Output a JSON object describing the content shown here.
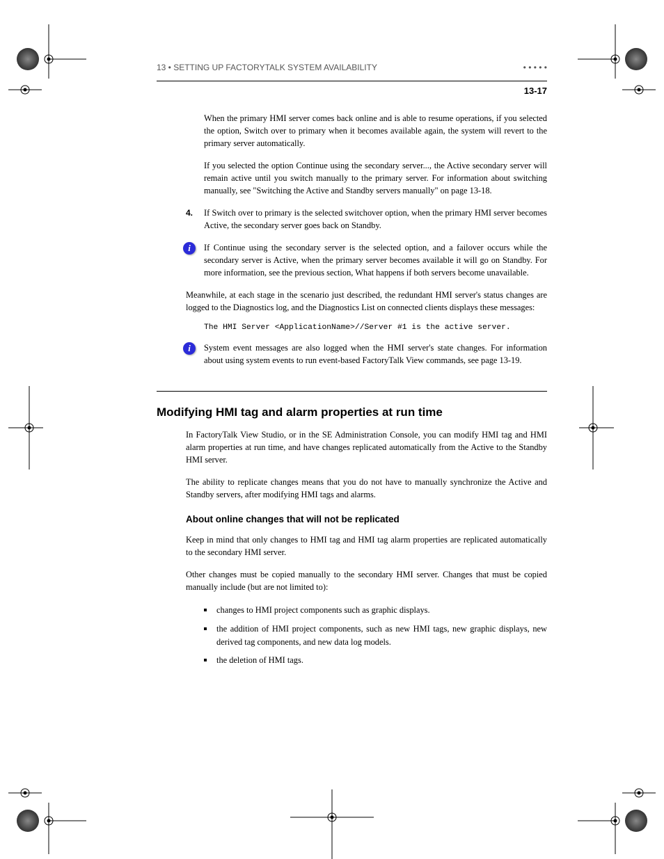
{
  "header": {
    "left": "13 • SETTING UP FACTORYTALK SYSTEM AVAILABILITY",
    "right": "• • • • •",
    "section_number": "13-17"
  },
  "para1": "When the primary HMI server comes back online and is able to resume operations, if you selected the option, Switch over to primary when it becomes available again, the system will revert to the primary server automatically.",
  "para2": "If you selected the option Continue using the secondary server..., the Active secondary server will remain active until you switch manually to the primary server. For information about switching manually, see \"Switching the Active and Standby servers manually\" on page 13-18.",
  "step1_num": "4.",
  "step1": "If Switch over to primary is the selected switchover option, when the primary HMI server becomes Active, the secondary server goes back on Standby.",
  "note1": "If Continue using the secondary server is the selected option, and a failover occurs while the secondary server is Active, when the primary server becomes available it will go on Standby. For more information, see the previous section, What happens if both servers become unavailable.",
  "para3": "Meanwhile, at each stage in the scenario just described, the redundant HMI server's status changes are logged to the Diagnostics log, and the Diagnostics List on connected clients displays these messages:",
  "code_line": "The HMI Server <ApplicationName>//Server #1 is the active server.",
  "note2": "System event messages are also logged when the HMI server's state changes. For information about using system events to run event-based FactoryTalk View commands, see page 13-19.",
  "h2": "Modifying HMI tag and alarm properties at run time",
  "para4": "In FactoryTalk View Studio, or in the SE Administration Console, you can modify HMI tag and HMI alarm properties at run time, and have changes replicated automatically from the Active to the Standby HMI server.",
  "para5": "The ability to replicate changes means that you do not have to manually synchronize the Active and Standby servers, after modifying HMI tags and alarms.",
  "h3": "About online changes that will not be replicated",
  "para6": "Keep in mind that only changes to HMI tag and HMI tag alarm properties are replicated automatically to the secondary HMI server.",
  "para7": "Other changes must be copied manually to the secondary HMI server. Changes that must be copied manually include (but are not limited to):",
  "bullets": [
    "changes to HMI project components such as graphic displays.",
    "the addition of HMI project components, such as new HMI tags, new graphic displays, new derived tag components, and new data log models.",
    "the deletion of HMI tags."
  ]
}
